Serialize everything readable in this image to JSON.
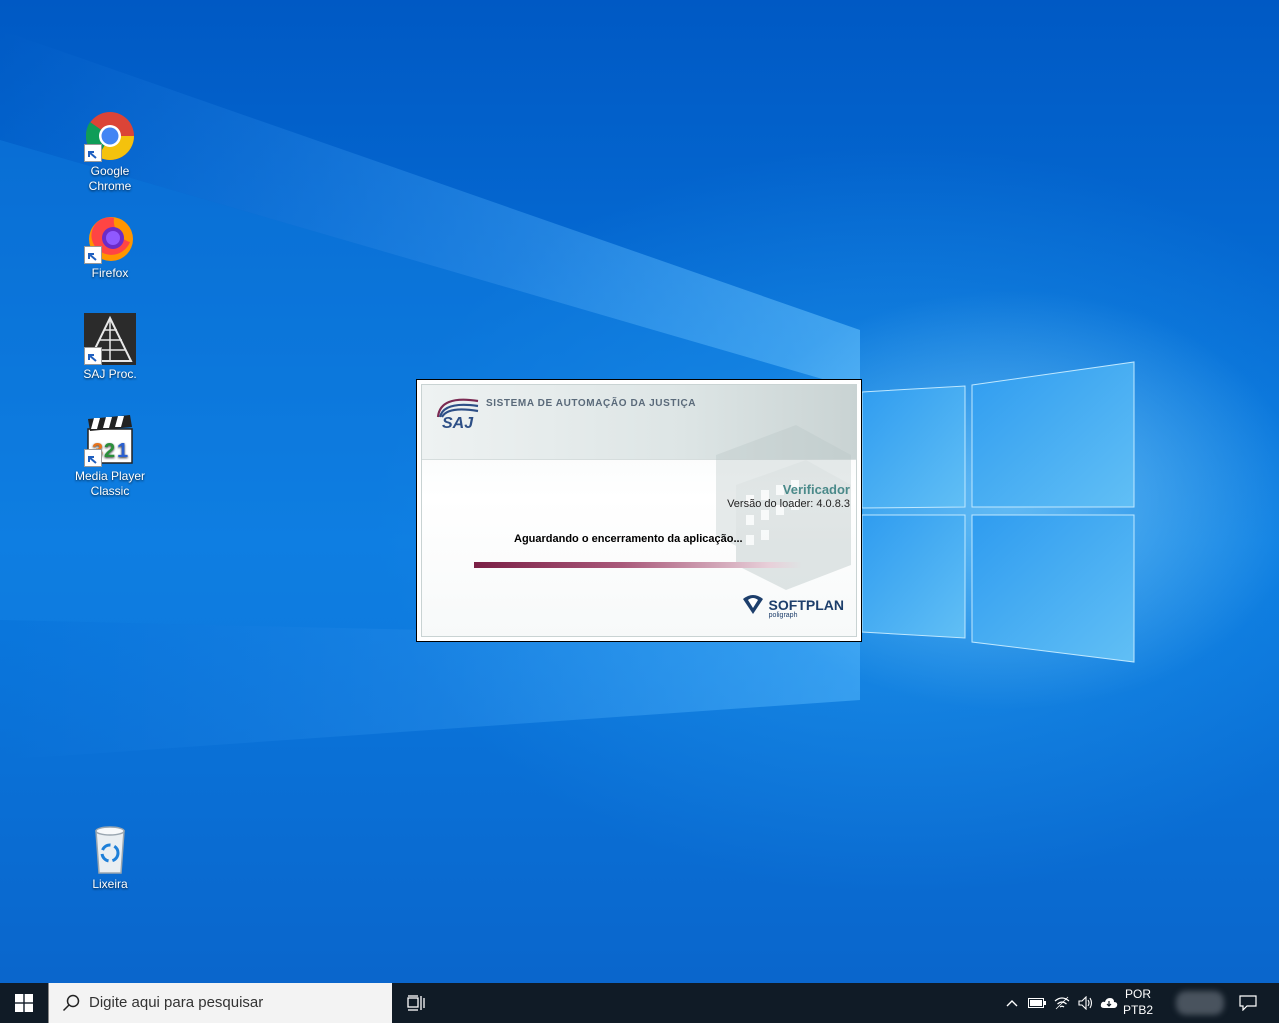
{
  "desktop": {
    "icons": [
      {
        "label_line1": "Google",
        "label_line2": "Chrome",
        "icon": "chrome-icon"
      },
      {
        "label_line1": "Firefox",
        "label_line2": "",
        "icon": "firefox-icon"
      },
      {
        "label_line1": "SAJ Proc.",
        "label_line2": "",
        "icon": "saj-proc-icon"
      },
      {
        "label_line1": "Media Player",
        "label_line2": "Classic",
        "icon": "media-player-classic-icon"
      },
      {
        "label_line1": "Lixeira",
        "label_line2": "",
        "icon": "recycle-bin-icon"
      }
    ]
  },
  "dialog": {
    "logo_text": "SAJ",
    "system_title": "SISTEMA DE AUTOMAÇÃO DA JUSTIÇA",
    "verificador": "Verificador",
    "versao": "Versão do loader: 4.0.8.3",
    "status": "Aguardando o encerramento da aplicação...",
    "progress_fraction": 1.0,
    "brand": "SOFTPLAN",
    "brand_sub": "poligraph"
  },
  "taskbar": {
    "search_placeholder": "Digite aqui para pesquisar",
    "lang_line1": "POR",
    "lang_line2": "PTB2"
  }
}
